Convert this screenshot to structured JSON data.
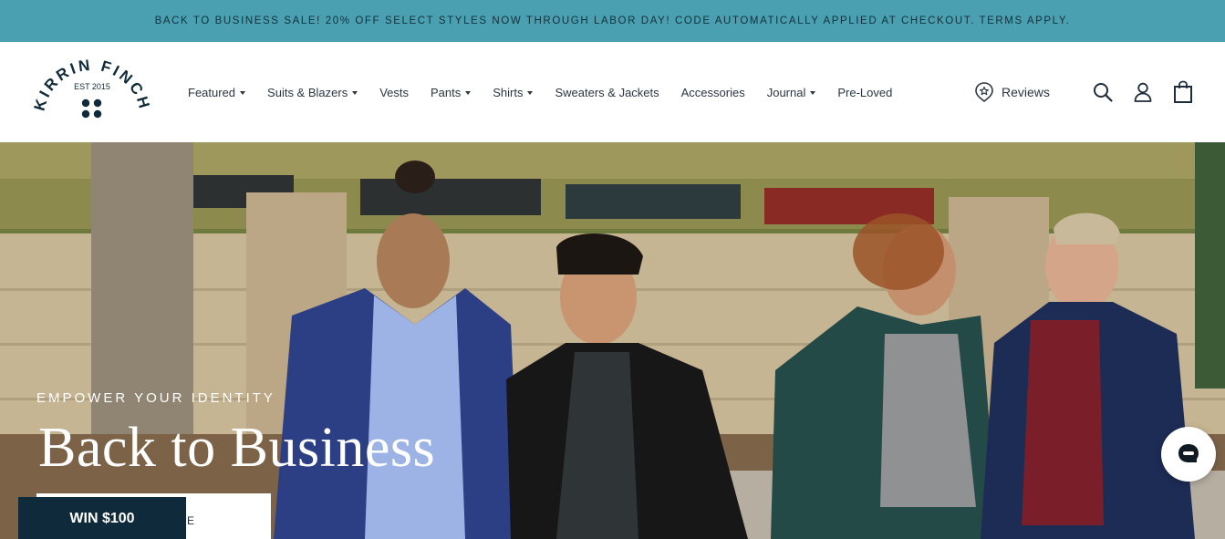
{
  "announcement": {
    "text": "BACK TO BUSINESS SALE! 20% OFF SELECT STYLES NOW THROUGH LABOR DAY! CODE AUTOMATICALLY APPLIED AT CHECKOUT. TERMS APPLY."
  },
  "logo": {
    "name": "KIRRIN FINCH",
    "est": "EST 2015"
  },
  "nav": {
    "items": [
      {
        "label": "Featured",
        "dropdown": true
      },
      {
        "label": "Suits & Blazers",
        "dropdown": true
      },
      {
        "label": "Vests",
        "dropdown": false
      },
      {
        "label": "Pants",
        "dropdown": true
      },
      {
        "label": "Shirts",
        "dropdown": true
      },
      {
        "label": "Sweaters & Jackets",
        "dropdown": false
      },
      {
        "label": "Accessories",
        "dropdown": false
      },
      {
        "label": "Journal",
        "dropdown": true
      },
      {
        "label": "Pre-Loved",
        "dropdown": false
      }
    ]
  },
  "header_actions": {
    "reviews_label": "Reviews",
    "icons": [
      "star-badge-icon",
      "search-icon",
      "account-icon",
      "cart-icon"
    ]
  },
  "hero": {
    "eyebrow": "EMPOWER YOUR IDENTITY",
    "title": "Back to Business",
    "button_visible_text": "E"
  },
  "promo": {
    "win_label": "WIN $100"
  },
  "chat": {
    "icon": "chat-icon"
  },
  "colors": {
    "announcement_bg": "#4a9fb0",
    "brand_navy": "#0f2a3a",
    "text": "#2a3642"
  }
}
